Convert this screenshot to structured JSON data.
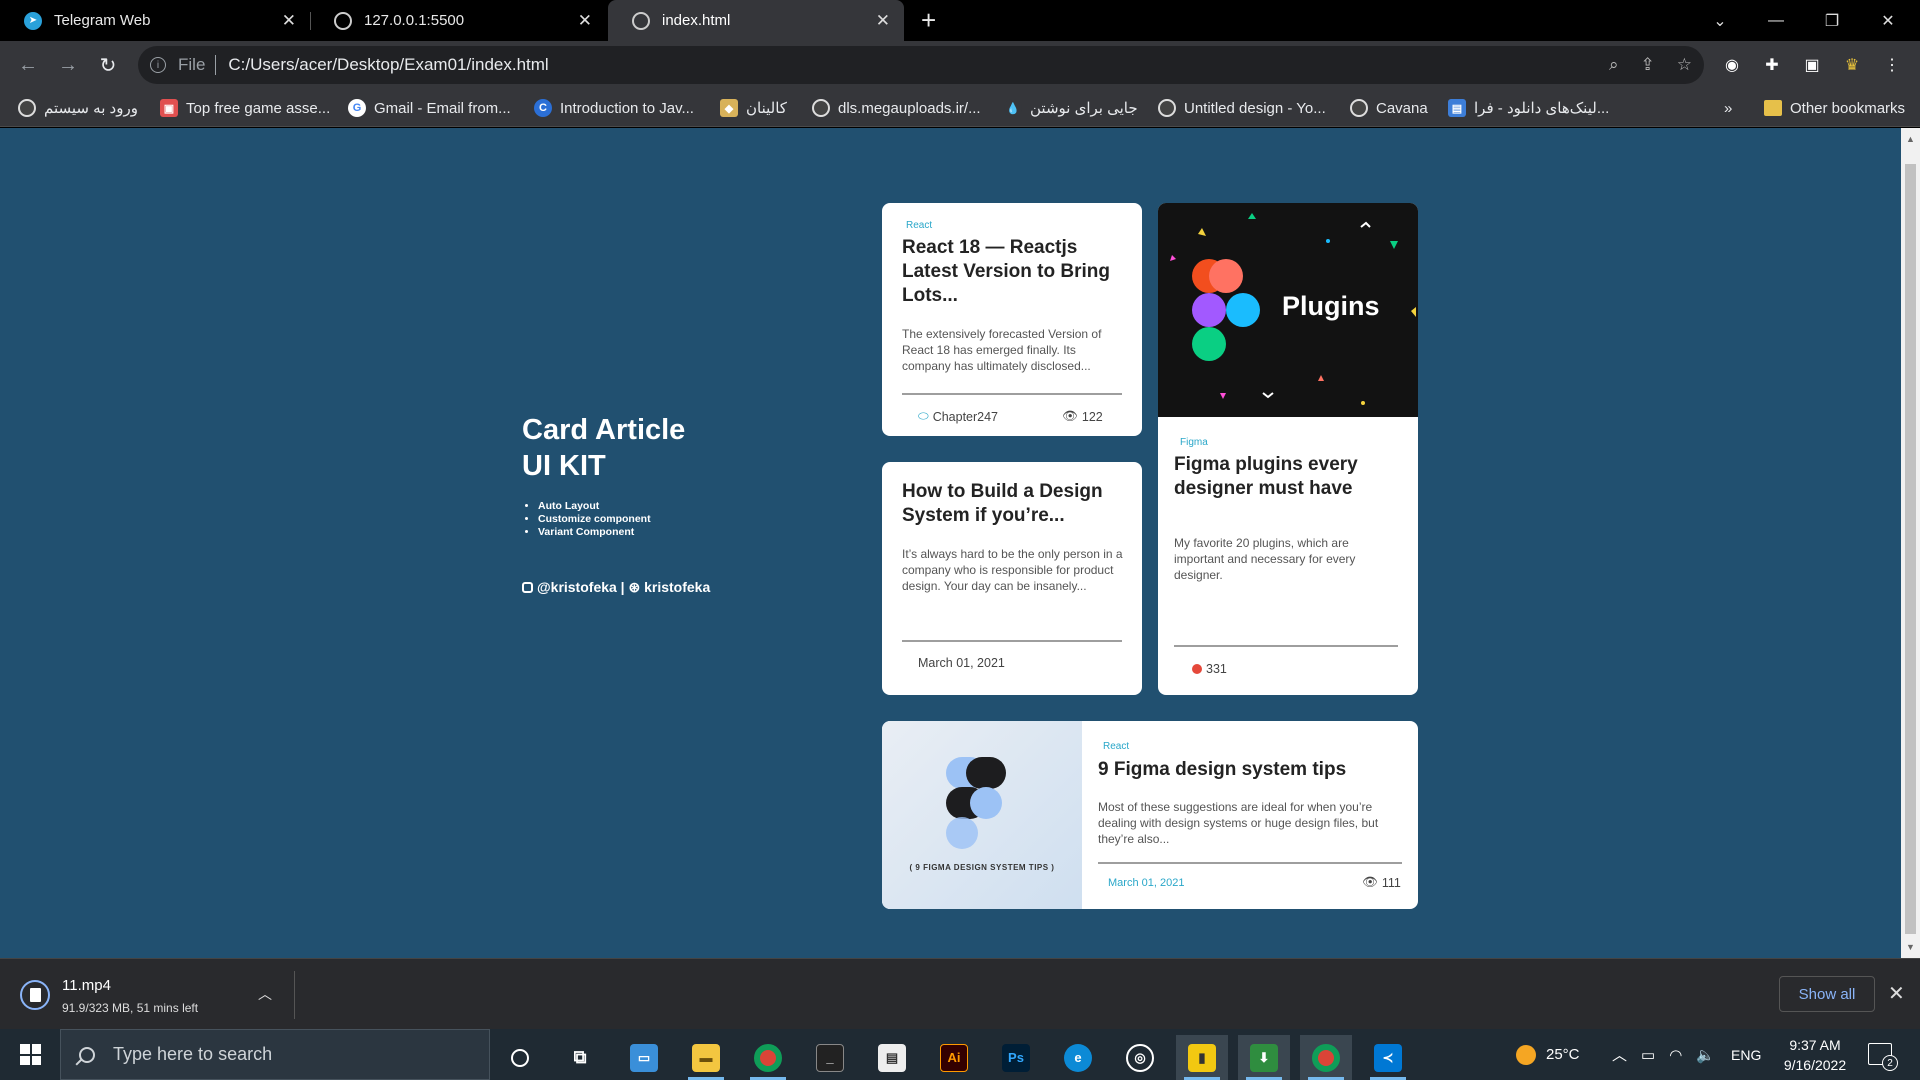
{
  "browser": {
    "tabs": [
      {
        "title": "Telegram Web",
        "active": false
      },
      {
        "title": "127.0.0.1:5500",
        "active": false
      },
      {
        "title": "index.html",
        "active": true
      }
    ],
    "new_tab": "+",
    "address": {
      "scheme": "File",
      "url": "C:/Users/acer/Desktop/Exam01/index.html"
    },
    "bookmarks": [
      {
        "label": "ورود به سیستم"
      },
      {
        "label": "Top free game asse..."
      },
      {
        "label": "Gmail - Email from..."
      },
      {
        "label": "Introduction to Jav..."
      },
      {
        "label": "کالینان"
      },
      {
        "label": "dls.megauploads.ir/..."
      },
      {
        "label": "جایی برای نوشتن"
      },
      {
        "label": "Untitled design - Yo..."
      },
      {
        "label": "Cavana"
      },
      {
        "label": "لینک‌های دانلود - فرا..."
      }
    ],
    "bookmarks_overflow": "»",
    "other_bookmarks": "Other bookmarks"
  },
  "page": {
    "hero": {
      "title_line1": "Card Article",
      "title_line2": "UI KIT",
      "features": [
        "Auto Layout",
        "Customize component",
        "Variant Component"
      ],
      "handle": "@kristofeka | ⊛ kristofeka"
    },
    "cards": {
      "react18": {
        "tag": "React",
        "title": "React 18 — Reactjs Latest Version to Bring Lots...",
        "desc": "The extensively forecasted Version of React 18 has emerged finally. Its company has ultimately disclosed...",
        "author": "Chapter247",
        "views": "122"
      },
      "design_system": {
        "title": "How to Build a Design System if you’re...",
        "desc": "It’s always hard to be the only person in a company who is responsible for product design. Your day can be insanely...",
        "date": "March 01, 2021"
      },
      "figma_plugins": {
        "image_text": "Plugins",
        "tag": "Figma",
        "title": "Figma plugins every designer must have",
        "desc": "My favorite 20 plugins, which are important and necessary for every designer.",
        "count": "331"
      },
      "figma_tips": {
        "image_caption": "( 9 FIGMA DESIGN SYSTEM TIPS )",
        "tag": "React",
        "title": "9 Figma design system tips",
        "desc": "Most of these suggestions are ideal for when you’re dealing with design systems or huge design files, but they’re also...",
        "date": "March 01, 2021",
        "views": "111"
      }
    }
  },
  "downloads": {
    "file": "11.mp4",
    "status": "91.9/323 MB, 51 mins left",
    "show_all": "Show all"
  },
  "taskbar": {
    "search_placeholder": "Type here to search",
    "temperature": "25°C",
    "language": "ENG",
    "time": "9:37 AM",
    "date": "9/16/2022",
    "notifications": "2"
  },
  "colors": {
    "page_bg": "#215070",
    "accent_tag": "#2aa7c9",
    "card_bg": "#ffffff"
  }
}
